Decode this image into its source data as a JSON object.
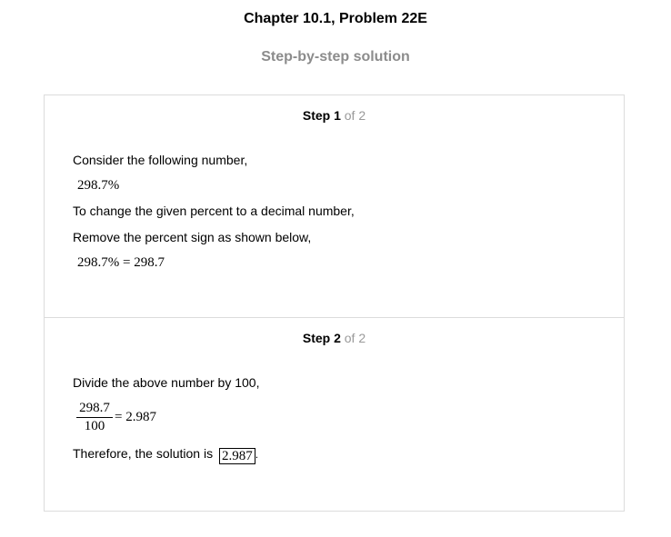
{
  "header": {
    "chapter_title": "Chapter 10.1, Problem 22E",
    "subtitle": "Step-by-step solution"
  },
  "steps": [
    {
      "step_word": "Step 1",
      "of_total": " of 2",
      "lines": {
        "consider": "Consider the following number,",
        "number": "298.7%",
        "instruction": "To change the given percent to a decimal number,",
        "remove": "Remove the percent sign as shown below,",
        "equation": "298.7% = 298.7"
      }
    },
    {
      "step_word": "Step 2",
      "of_total": " of 2",
      "lines": {
        "divide": "Divide the above number by 100,",
        "numerator": "298.7",
        "denominator": "100",
        "result": "= 2.987",
        "therefore": "Therefore, the solution is",
        "answer": "2.987",
        "period": "."
      }
    }
  ]
}
